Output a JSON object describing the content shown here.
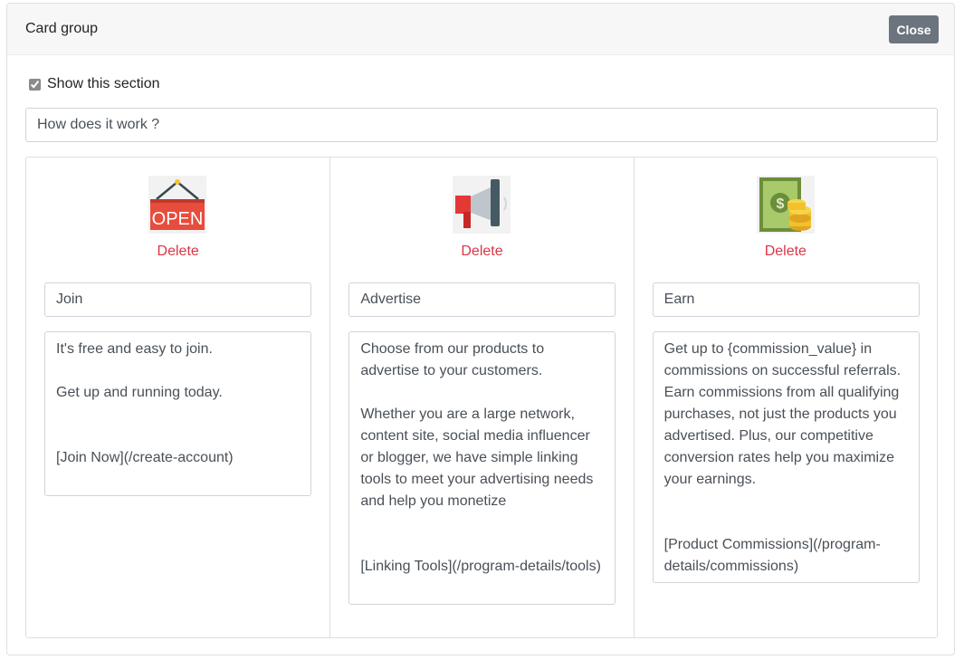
{
  "header": {
    "title": "Card group",
    "close_label": "Close"
  },
  "section": {
    "show_label": "Show this section",
    "show_checked": true,
    "title_value": "How does it work ?"
  },
  "cards": [
    {
      "icon": "open-sign-icon",
      "delete_label": "Delete",
      "name": "Join",
      "description": "It's free and easy to join.\n\nGet up and running today.\n\n\n[Join Now](/create-account)"
    },
    {
      "icon": "megaphone-icon",
      "delete_label": "Delete",
      "name": "Advertise",
      "description": "Choose from our products to advertise to your customers.\n\nWhether you are a large network, content site, social media influencer or blogger, we have simple linking tools to meet your advertising needs and help you monetize\n\n\n[Linking Tools](/program-details/tools)"
    },
    {
      "icon": "money-coins-icon",
      "delete_label": "Delete",
      "name": "Earn",
      "description": "Get up to {commission_value} in commissions on successful referrals. Earn commissions from all qualifying purchases, not just the products you advertised. Plus, our competitive conversion rates help you maximize your earnings.\n\n\n[Product Commissions](/program-details/commissions)"
    }
  ],
  "colors": {
    "delete": "#dc3545",
    "close_button": "#6c757d",
    "header_bg": "#f7f7f7",
    "border": "#dfdfdf"
  }
}
